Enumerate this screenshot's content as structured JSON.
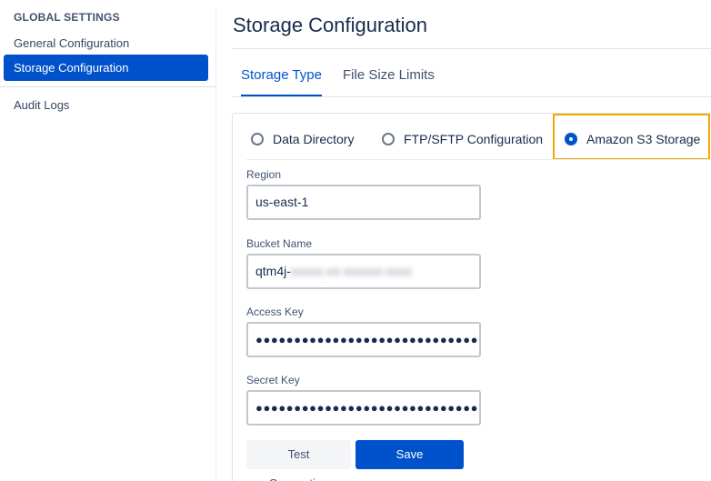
{
  "sidebar": {
    "heading": "GLOBAL SETTINGS",
    "items": [
      {
        "label": "General Configuration",
        "active": false
      },
      {
        "label": "Storage Configuration",
        "active": true
      },
      {
        "label": "Audit Logs",
        "active": false
      }
    ]
  },
  "main": {
    "title": "Storage Configuration",
    "tabs": [
      {
        "label": "Storage Type",
        "active": true
      },
      {
        "label": "File Size Limits",
        "active": false
      }
    ],
    "storage_options": [
      {
        "label": "Data Directory",
        "checked": false
      },
      {
        "label": "FTP/SFTP Configuration",
        "checked": false
      },
      {
        "label": "Amazon S3 Storage",
        "checked": true
      }
    ],
    "form": {
      "region_label": "Region",
      "region_value": "us-east-1",
      "bucket_label": "Bucket Name",
      "bucket_value_prefix": "qtm4j-",
      "bucket_value_redacted": "xxxxx-xx-xxxxxx-xxxx",
      "access_key_label": "Access Key",
      "access_key_value": "●●●●●●●●●●●●●●●●●●●●●●●●●●●●●●●",
      "secret_key_label": "Secret Key",
      "secret_key_value": "●●●●●●●●●●●●●●●●●●●●●●●●●●●●●●●"
    },
    "buttons": {
      "test_label": "Test Connection",
      "save_label": "Save Connection"
    }
  },
  "colors": {
    "accent": "#0052cc",
    "highlight": "#f2a900"
  }
}
